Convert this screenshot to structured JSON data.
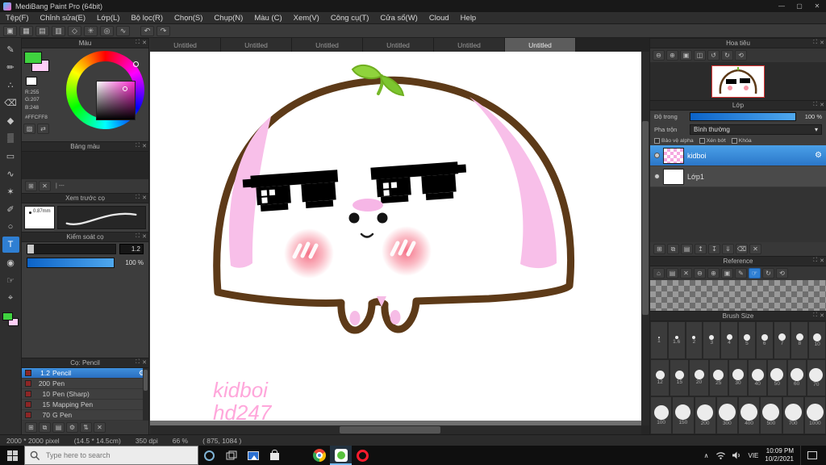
{
  "window": {
    "title": "MediBang Paint Pro (64bit)",
    "minimize": "—",
    "maximize": "▢",
    "close": "✕"
  },
  "menubar": [
    "Tệp(F)",
    "Chỉnh sửa(E)",
    "Lớp(L)",
    "Bộ lọc(R)",
    "Chọn(S)",
    "Chụp(N)",
    "Màu (C)",
    "Xem(V)",
    "Công cụ(T)",
    "Cửa sổ(W)",
    "Cloud",
    "Help"
  ],
  "toolbar": {
    "icons": [
      {
        "name": "snap-off-icon",
        "glyph": "▣"
      },
      {
        "name": "snap-grid-icon",
        "glyph": "▦"
      },
      {
        "name": "snap-parallel-icon",
        "glyph": "▤"
      },
      {
        "name": "snap-cross-icon",
        "glyph": "▥"
      },
      {
        "name": "snap-vanish-icon",
        "glyph": "◇"
      },
      {
        "name": "snap-radial-icon",
        "glyph": "✳"
      },
      {
        "name": "snap-circle-icon",
        "glyph": "◎"
      },
      {
        "name": "snap-curve-icon",
        "glyph": "∿"
      }
    ],
    "undo": "↶",
    "redo": "↷"
  },
  "tools_strip": [
    {
      "name": "brush-tool-icon",
      "glyph": "✎"
    },
    {
      "name": "pencil-tool-icon",
      "glyph": "✏"
    },
    {
      "name": "airbrush-tool-icon",
      "glyph": "∴"
    },
    {
      "name": "eraser-tool-icon",
      "glyph": "⌫"
    },
    {
      "name": "bucket-tool-icon",
      "glyph": "◆"
    },
    {
      "name": "gradient-tool-icon",
      "glyph": "▒"
    },
    {
      "name": "select-tool-icon",
      "glyph": "▭"
    },
    {
      "name": "lasso-tool-icon",
      "glyph": "∿"
    },
    {
      "name": "magic-wand-tool-icon",
      "glyph": "✶"
    },
    {
      "name": "select-pen-tool-icon",
      "glyph": "✐"
    },
    {
      "name": "shape-tool-icon",
      "glyph": "○"
    },
    {
      "name": "text-tool-icon",
      "glyph": "T",
      "active": true
    },
    {
      "name": "eyedropper-tool-icon",
      "glyph": "◉"
    },
    {
      "name": "hand-tool-icon",
      "glyph": "☞"
    },
    {
      "name": "zoom-tool-icon",
      "glyph": "⌖"
    }
  ],
  "color_panel": {
    "title": "Màu",
    "r": "R:255",
    "g": "G:207",
    "b": "B:248",
    "hex": "#FFCFF8",
    "fg_color": "#3fd23f",
    "bg_color": "#ffcff8",
    "action_icons": [
      {
        "name": "transparent-color-icon",
        "glyph": "▨"
      },
      {
        "name": "swap-color-icon",
        "glyph": "⇄"
      }
    ]
  },
  "palette_panel": {
    "title": "Bảng màu",
    "footer_label": "| ---",
    "footer_icons": [
      {
        "name": "add-swatch-icon",
        "glyph": "⊞"
      },
      {
        "name": "delete-swatch-icon",
        "glyph": "✕"
      }
    ]
  },
  "preview_panel": {
    "title": "Xem trước cọ",
    "size": "0.87mm"
  },
  "control_panel": {
    "title": "Kiểm soát cọ",
    "size_value": "1.2",
    "opacity_value": "100 %"
  },
  "brush_panel": {
    "title": "Cọ: Pencil",
    "items": [
      {
        "size": "1.2",
        "name": "Pencil",
        "selected": true
      },
      {
        "size": "200",
        "name": "Pen"
      },
      {
        "size": "10",
        "name": "Pen (Sharp)"
      },
      {
        "size": "15",
        "name": "Mapping Pen"
      },
      {
        "size": "70",
        "name": "G Pen"
      }
    ],
    "footer_icons": [
      {
        "name": "add-brush-icon",
        "glyph": "⊞"
      },
      {
        "name": "duplicate-brush-icon",
        "glyph": "⧉"
      },
      {
        "name": "brush-folder-icon",
        "glyph": "▤"
      },
      {
        "name": "brush-settings-icon",
        "glyph": "⚙"
      },
      {
        "name": "reorder-brush-icon",
        "glyph": "⇅"
      },
      {
        "name": "delete-brush-icon",
        "glyph": "✕"
      }
    ]
  },
  "navigator": {
    "title": "Hoa tiêu",
    "icons": [
      {
        "name": "zoom-out-icon",
        "glyph": "⊖"
      },
      {
        "name": "zoom-in-icon",
        "glyph": "⊕"
      },
      {
        "name": "fit-window-icon",
        "glyph": "▣"
      },
      {
        "name": "actual-size-icon",
        "glyph": "◫"
      },
      {
        "name": "rotate-left-icon",
        "glyph": "↺"
      },
      {
        "name": "rotate-right-icon",
        "glyph": "↻"
      },
      {
        "name": "reset-view-icon",
        "glyph": "⟲"
      }
    ]
  },
  "layers": {
    "title": "Lớp",
    "opacity_label": "Độ trong",
    "opacity_value": "100 %",
    "blend_label": "Pha trộn",
    "blend_value": "Bình thường",
    "checks": [
      "Bảo vệ alpha",
      "Xén bớt",
      "Khóa"
    ],
    "items": [
      {
        "name": "kidboi",
        "selected": true,
        "thumb": "pink"
      },
      {
        "name": "Lớp1",
        "selected": false,
        "thumb": "white"
      }
    ],
    "footer_icons": [
      {
        "name": "add-layer-icon",
        "glyph": "⊞"
      },
      {
        "name": "duplicate-layer-icon",
        "glyph": "⧉"
      },
      {
        "name": "layer-folder-icon",
        "glyph": "▤"
      },
      {
        "name": "layer-up-icon",
        "glyph": "↥"
      },
      {
        "name": "layer-down-icon",
        "glyph": "↧"
      },
      {
        "name": "merge-layer-icon",
        "glyph": "⇓"
      },
      {
        "name": "clear-layer-icon",
        "glyph": "⌫"
      },
      {
        "name": "delete-layer-icon",
        "glyph": "✕"
      }
    ]
  },
  "reference": {
    "title": "Reference",
    "icons": [
      {
        "name": "home-icon",
        "glyph": "⌂"
      },
      {
        "name": "open-image-icon",
        "glyph": "▤"
      },
      {
        "name": "close-image-icon",
        "glyph": "✕"
      },
      {
        "name": "zoom-out-icon",
        "glyph": "⊖"
      },
      {
        "name": "zoom-in-icon",
        "glyph": "⊕"
      },
      {
        "name": "fit-icon",
        "glyph": "▣"
      },
      {
        "name": "dropper-icon",
        "glyph": "✎"
      },
      {
        "name": "hand-icon",
        "glyph": "☞",
        "active": true
      },
      {
        "name": "rotate-icon",
        "glyph": "↻"
      },
      {
        "name": "reset-icon",
        "glyph": "⟲"
      }
    ]
  },
  "brush_size": {
    "title": "Brush Size",
    "rows": [
      [
        "1",
        "1.6",
        "2",
        "3",
        "4",
        "5",
        "6",
        "7",
        "8",
        "10"
      ],
      [
        "12",
        "15",
        "20",
        "25",
        "30",
        "40",
        "50",
        "60",
        "70"
      ],
      [
        "100",
        "150",
        "200",
        "300",
        "400",
        "500",
        "700",
        "1000"
      ]
    ]
  },
  "canvas": {
    "tabs": [
      "Untitled",
      "Untitled",
      "Untitled",
      "Untitled",
      "Untitled",
      "Untitled"
    ],
    "active_tab": 5,
    "signature": [
      "kidboi",
      "hd247"
    ]
  },
  "statusbar": {
    "size": "2000 * 2000 pixel",
    "dims": "(14.5 * 14.5cm)",
    "dpi": "350 dpi",
    "zoom": "66 %",
    "coords": "( 875, 1084 )"
  },
  "taskbar": {
    "search_placeholder": "Type here to search",
    "lang": "VIE",
    "time": "10:09 PM",
    "date": "10/2/2021"
  }
}
